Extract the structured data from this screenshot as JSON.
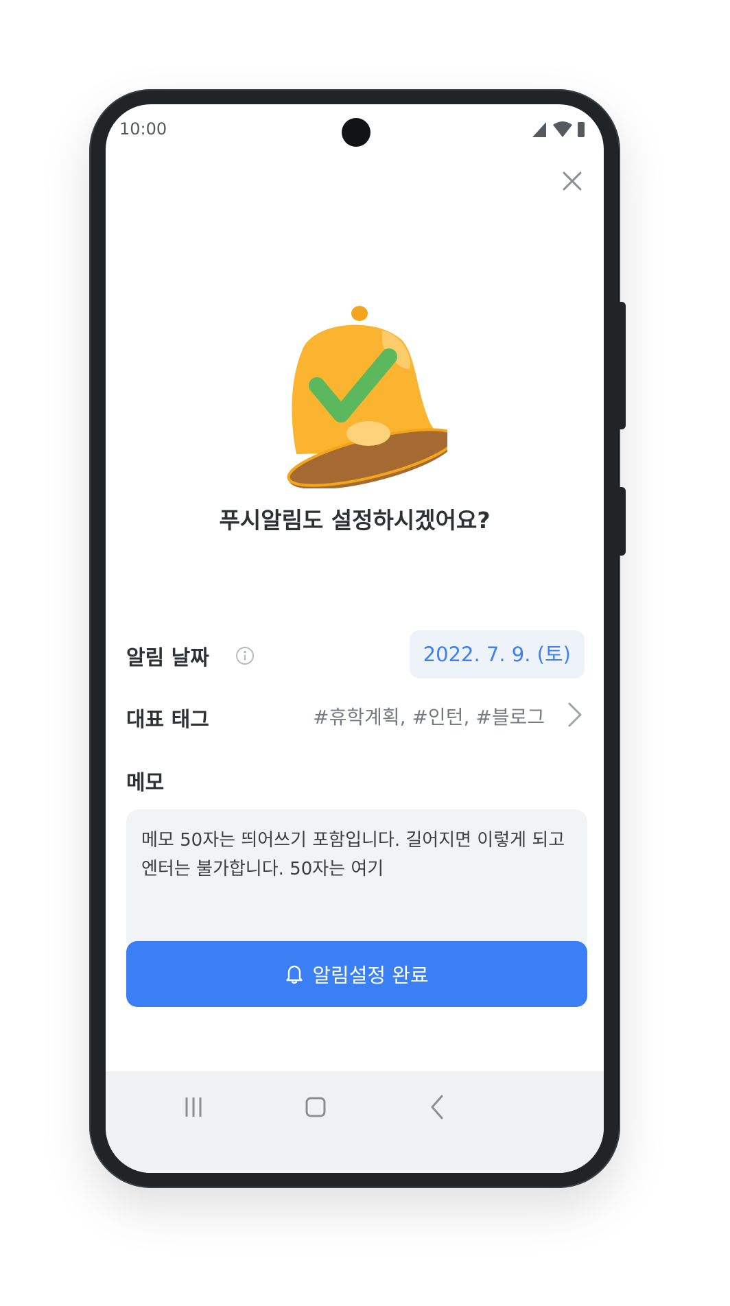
{
  "status_bar": {
    "time": "10:00"
  },
  "dialog": {
    "close_icon": "close-icon",
    "hero_icon": "bell-check-icon",
    "headline": "푸시알림도 설정하시겠어요?"
  },
  "fields": {
    "date": {
      "label": "알림 날짜",
      "info_icon": "info-icon",
      "value": "2022. 7. 9. (토)"
    },
    "tags": {
      "label": "대표 태그",
      "value": "#휴학계획, #인턴, #블로그",
      "chevron_icon": "chevron-right-icon"
    },
    "memo": {
      "label": "메모",
      "value": "메모 50자는 띄어쓰기 포함입니다. 길어지면 이렇게 되고 엔터는 불가합니다. 50자는 여기"
    }
  },
  "cta": {
    "icon": "bell-icon",
    "label": "알림설정 완료",
    "color": "#3b7ff5"
  },
  "colors": {
    "accent": "#3b7ff5",
    "chip_bg": "#eef2f9",
    "bell_body": "#fbb430",
    "check": "#5cb85c"
  },
  "nav_bar": {
    "recent_icon": "recent-apps-icon",
    "home_icon": "home-icon",
    "back_icon": "back-icon"
  }
}
